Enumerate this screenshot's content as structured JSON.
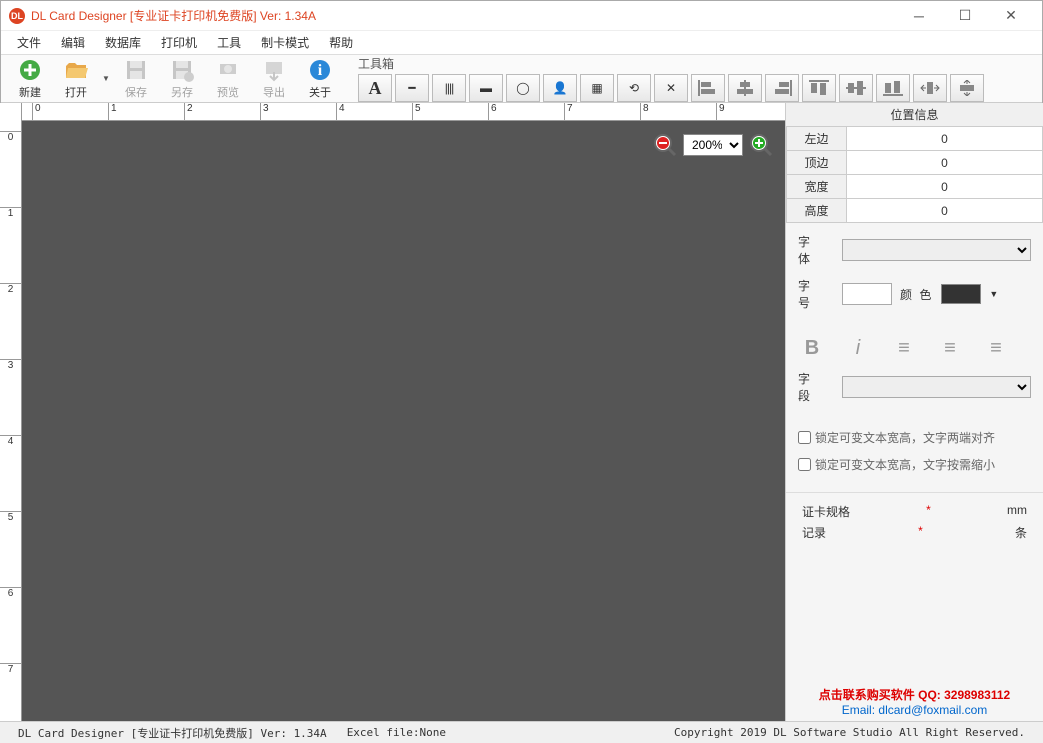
{
  "titlebar": {
    "title": "DL Card Designer [专业证卡打印机免费版] Ver: 1.34A"
  },
  "menu": [
    "文件",
    "编辑",
    "数据库",
    "打印机",
    "工具",
    "制卡模式",
    "帮助"
  ],
  "toolbar": {
    "new": "新建",
    "open": "打开",
    "save": "保存",
    "saveas": "另存",
    "preview": "预览",
    "export": "导出",
    "about": "关于"
  },
  "toolbox": {
    "label": "工具箱"
  },
  "zoom": {
    "value": "200%"
  },
  "hruler": [
    "0",
    "1",
    "2",
    "3",
    "4",
    "5",
    "6",
    "7",
    "8",
    "9"
  ],
  "vruler": [
    "0",
    "1",
    "2",
    "3",
    "4",
    "5",
    "6",
    "7"
  ],
  "panel": {
    "title": "位置信息",
    "pos": {
      "left_lbl": "左边",
      "left": "0",
      "top_lbl": "顶边",
      "top": "0",
      "w_lbl": "宽度",
      "w": "0",
      "h_lbl": "高度",
      "h": "0"
    },
    "font_lbl": "字 体",
    "size_lbl": "字 号",
    "color_lbl": "颜 色",
    "field_lbl": "字 段",
    "chk1": "锁定可变文本宽高，文字两端对齐",
    "chk2": "锁定可变文本宽高，文字按需缩小",
    "spec_lbl": "证卡规格",
    "spec_unit": "mm",
    "spec_star": "*",
    "rec_lbl": "记录",
    "rec_unit": "条",
    "rec_star": "*",
    "contact1": "点击联系购买软件 QQ: 3298983112",
    "contact2": "Email: dlcard@foxmail.com"
  },
  "status": {
    "s1": "DL Card Designer [专业证卡打印机免费版] Ver: 1.34A",
    "s2": "Excel file:None",
    "s3": "Copyright 2019 DL Software Studio All Right Reserved."
  }
}
